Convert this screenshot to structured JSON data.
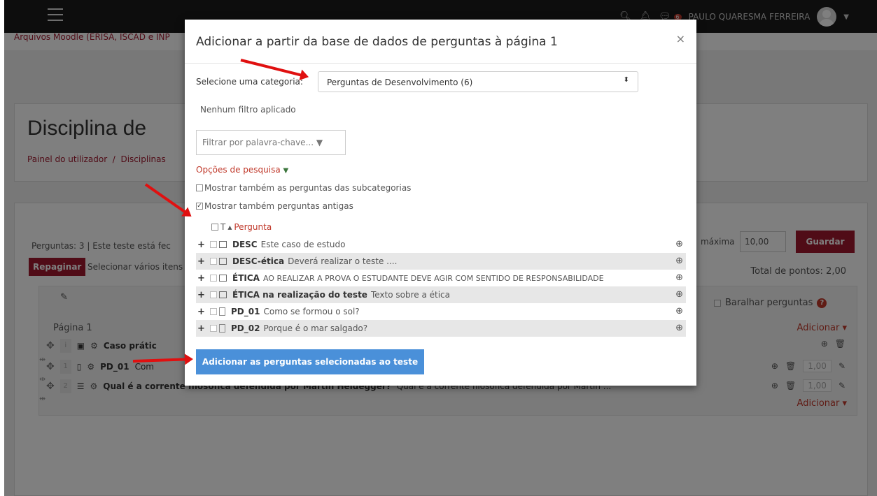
{
  "navbar": {
    "user_name": "PAULO QUARESMA FERREIRA",
    "message_count": "6"
  },
  "site": {
    "course_link": "Arquivos Moodle (ERISA, ISCAD e INP"
  },
  "header": {
    "heading": "Disciplina de",
    "crumb_home": "Painel do utilizador",
    "crumb_sep": "/",
    "crumb_courses": "Disciplinas"
  },
  "quiz": {
    "info": "Perguntas: 3 | Este teste está fec",
    "max_grade_label": "máxima",
    "max_grade_value": "10,00",
    "save_label": "Guardar",
    "repaginate_label": "Repaginar",
    "select_multiple_label": "Selecionar vários itens",
    "total_points": "Total de pontos: 2,00",
    "shuffle_label": "Baralhar perguntas",
    "page_label": "Página 1",
    "add_label": "Adicionar",
    "slots": [
      {
        "num": "i",
        "name": "Caso prátic",
        "text": "",
        "mark": ""
      },
      {
        "num": "1",
        "name": "PD_01",
        "text": "Com",
        "mark": "1,00"
      },
      {
        "num": "2",
        "name": "Qual é a corrente filosófica defendida por Martin Heidegger?",
        "text": "Qual é a corrente filosófica defendida por Martin ...",
        "mark": "1,00"
      }
    ]
  },
  "modal": {
    "title": "Adicionar a partir da base de dados de perguntas à página 1",
    "close": "×",
    "category_label": "Selecione uma categoria:",
    "category_value": "Perguntas de Desenvolvimento (6)",
    "no_filter": "Nenhum filtro aplicado",
    "filter_placeholder": "Filtrar por palavra-chave... ▼",
    "search_options": "Opções de pesquisa",
    "show_subcategories": "Mostrar também as perguntas das subcategorias",
    "show_old": "Mostrar também perguntas antigas",
    "col_type": "T",
    "col_question": "Pergunta",
    "questions": [
      {
        "name": "DESC",
        "text": "Este caso de estudo",
        "kind": "desc"
      },
      {
        "name": "DESC-ética",
        "text": "Deverá realizar o teste ....",
        "kind": "desc"
      },
      {
        "name": "ÉTICA",
        "text": "AO REALIZAR A PROVA O ESTUDANTE DEVE AGIR COM SENTIDO DE RESPONSABILIDADE",
        "kind": "desc"
      },
      {
        "name": "ÉTICA na realização do teste",
        "text": "Texto sobre a ética",
        "kind": "desc"
      },
      {
        "name": "PD_01",
        "text": "Como se formou o sol?",
        "kind": "essay"
      },
      {
        "name": "PD_02",
        "text": "Porque é o mar salgado?",
        "kind": "essay"
      }
    ],
    "add_button": "Adicionar as perguntas selecionadas ao teste"
  },
  "colors": {
    "brand": "#a0182e",
    "primary_button": "#4a90d9",
    "annotation_arrow": "#e01010"
  }
}
